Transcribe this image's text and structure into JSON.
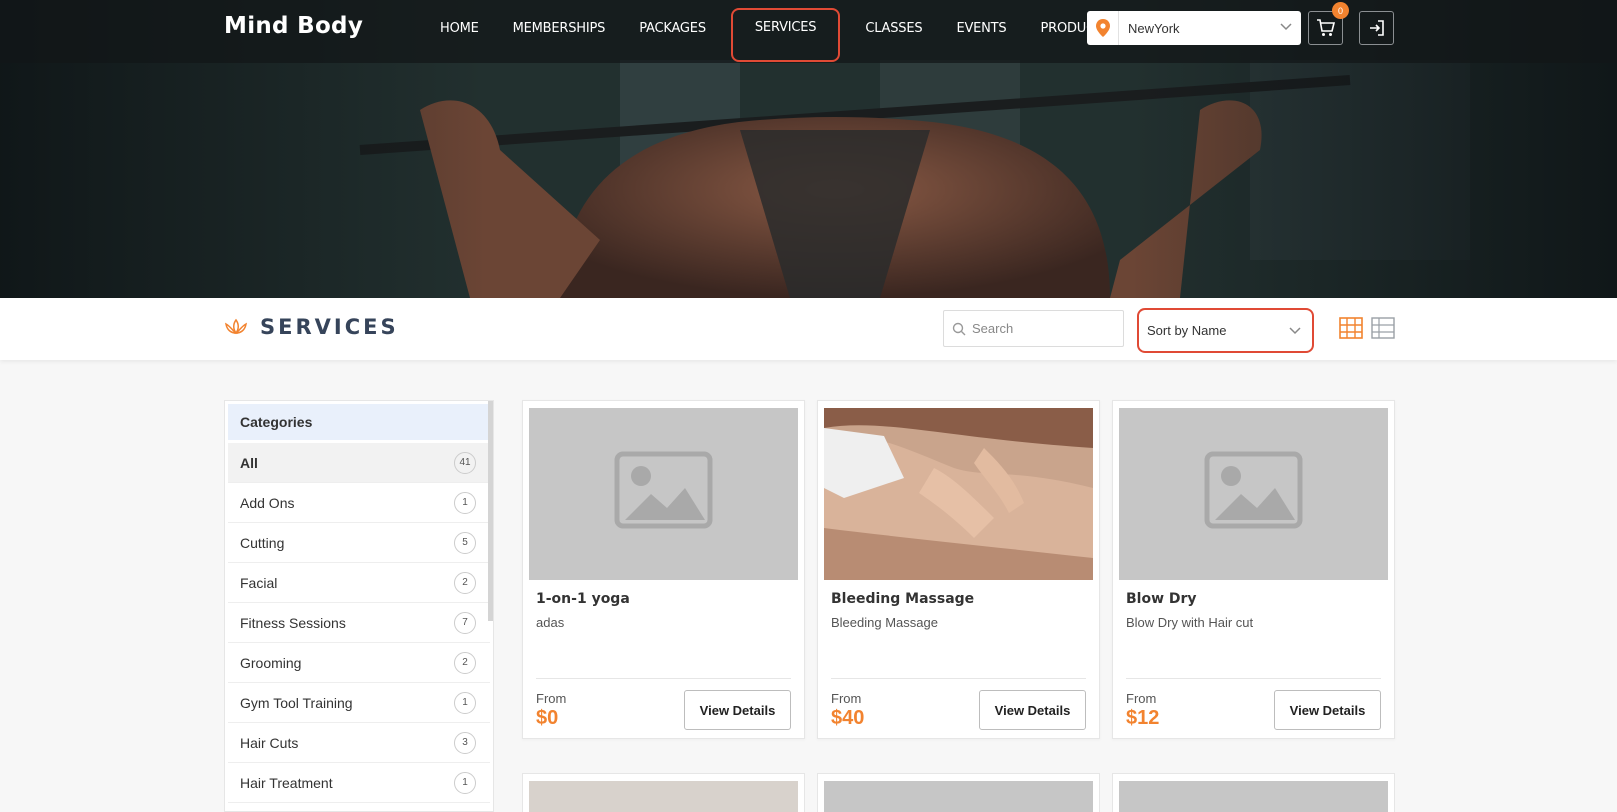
{
  "header": {
    "brand": "Mind Body",
    "nav": [
      {
        "label": "HOME",
        "active": false
      },
      {
        "label": "MEMBERSHIPS",
        "active": false
      },
      {
        "label": "PACKAGES",
        "active": false
      },
      {
        "label": "SERVICES",
        "active": true
      },
      {
        "label": "CLASSES",
        "active": false
      },
      {
        "label": "EVENTS",
        "active": false
      },
      {
        "label": "PRODUCTS",
        "active": false
      }
    ],
    "location": "NewYork",
    "cart_count": "0",
    "accent": "#f2832f"
  },
  "toolbar": {
    "title": "SERVICES",
    "search_placeholder": "Search",
    "sort_label": "Sort by Name",
    "highlight": "#e04a35"
  },
  "sidebar": {
    "heading": "Categories",
    "items": [
      {
        "name": "All",
        "count": "41"
      },
      {
        "name": "Add Ons",
        "count": "1"
      },
      {
        "name": "Cutting",
        "count": "5"
      },
      {
        "name": "Facial",
        "count": "2"
      },
      {
        "name": "Fitness Sessions",
        "count": "7"
      },
      {
        "name": "Grooming",
        "count": "2"
      },
      {
        "name": "Gym Tool Training",
        "count": "1"
      },
      {
        "name": "Hair Cuts",
        "count": "3"
      },
      {
        "name": "Hair Treatment",
        "count": "1"
      }
    ]
  },
  "cards": [
    {
      "title": "1-on-1 yoga",
      "desc": "adas",
      "from": "From",
      "price": "$0",
      "button": "View Details",
      "image": "placeholder"
    },
    {
      "title": "Bleeding Massage",
      "desc": "Bleeding Massage",
      "from": "From",
      "price": "$40",
      "button": "View Details",
      "image": "massage-photo"
    },
    {
      "title": "Blow Dry",
      "desc": "Blow Dry with Hair cut",
      "from": "From",
      "price": "$12",
      "button": "View Details",
      "image": "placeholder"
    }
  ]
}
